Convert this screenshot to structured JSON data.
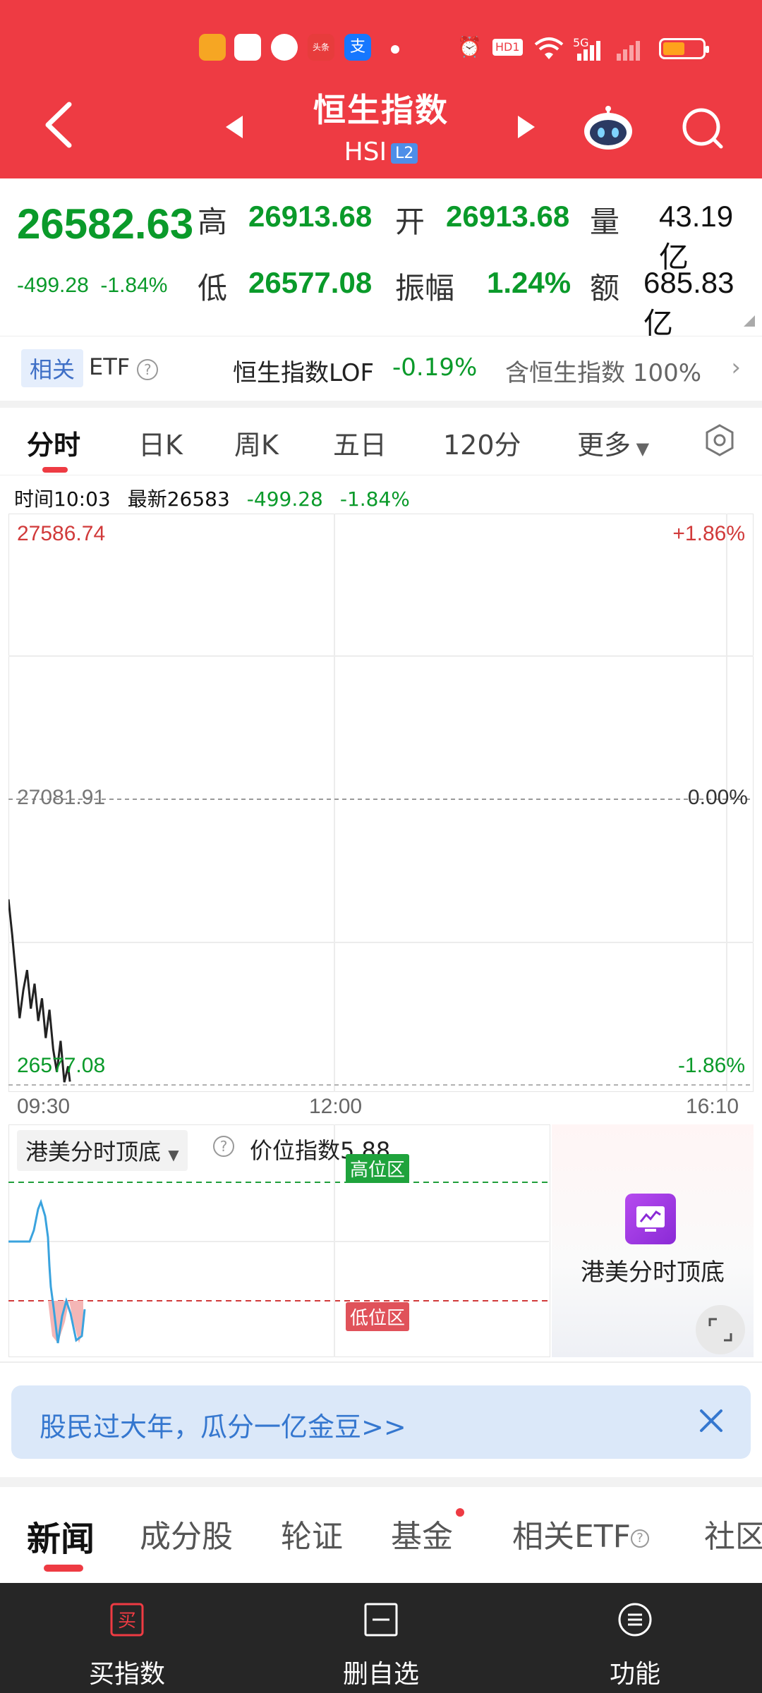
{
  "header": {
    "title": "恒生指数",
    "code": "HSI",
    "level_badge": "L2",
    "status_apps": [
      "头条",
      "支"
    ],
    "status_hd": "HD1",
    "status_5g": "5G",
    "accent_color": "#ee3b43"
  },
  "quote": {
    "price": "26582.63",
    "change": "-499.28",
    "change_pct": "-1.84%",
    "high_label": "高",
    "high": "26913.68",
    "open_label": "开",
    "open": "26913.68",
    "volume_label": "量",
    "volume": "43.19亿",
    "low_label": "低",
    "low": "26577.08",
    "amplitude_label": "振幅",
    "amplitude": "1.24%",
    "turnover_label": "额",
    "turnover": "685.83亿"
  },
  "etf": {
    "tag": "相关",
    "label": "ETF",
    "name": "恒生指数LOF",
    "pct": "-0.19%",
    "contains": "含恒生指数",
    "contains_pct": "100%"
  },
  "tabs": {
    "items": [
      "分时",
      "日K",
      "周K",
      "五日",
      "120分",
      "更多"
    ],
    "active": "分时"
  },
  "info": {
    "time": "时间10:03",
    "latest": "最新26583",
    "change": "-499.28",
    "change_pct": "-1.84%"
  },
  "chart_labels": {
    "top_price": "27586.74",
    "top_pct": "+1.86%",
    "mid_price": "27081.91",
    "mid_pct": "0.00%",
    "bottom_price": "26577.08",
    "bottom_pct": "-1.86%",
    "time_start": "09:30",
    "time_mid": "12:00",
    "time_end": "16:10"
  },
  "chart_data": {
    "type": "line",
    "x": [
      "09:30",
      "09:32",
      "09:34",
      "09:36",
      "09:38",
      "09:40",
      "09:42",
      "09:44",
      "09:46",
      "09:48",
      "09:50",
      "09:52",
      "09:54",
      "09:56",
      "09:58",
      "10:00",
      "10:02",
      "10:03"
    ],
    "y": [
      26905,
      26842,
      26770,
      26695,
      26745,
      26780,
      26712,
      26756,
      26690,
      26730,
      26660,
      26710,
      26640,
      26600,
      26655,
      26582,
      26610,
      26583
    ],
    "ylim": [
      26577.08,
      27586.74
    ],
    "reference": 27081.91,
    "x_range": [
      "09:30",
      "16:10"
    ]
  },
  "indicator": {
    "name": "港美分时顶底",
    "value_label": "价位指数5.88",
    "high_zone": "高位区",
    "low_zone": "低位区",
    "card_label": "港美分时顶底"
  },
  "promo": {
    "text": "股民过大年，瓜分一亿金豆>>"
  },
  "news_tabs": {
    "items": [
      "新闻",
      "成分股",
      "轮证",
      "基金",
      "相关ETF",
      "社区"
    ],
    "active": "新闻"
  },
  "bottom_bar": {
    "buy_icon_text": "买",
    "buy": "买指数",
    "remove": "删自选",
    "func": "功能"
  }
}
